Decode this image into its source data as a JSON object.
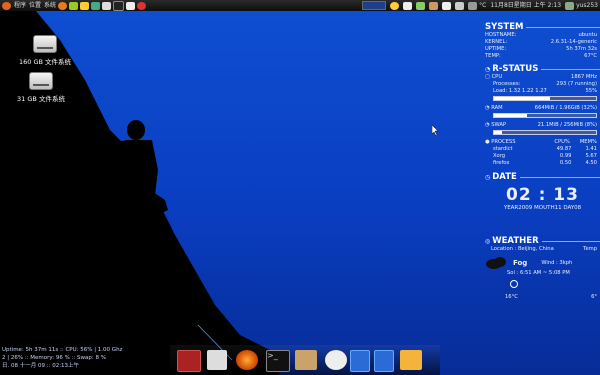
{
  "topbar": {
    "menus": [
      "ubuntu",
      "程序",
      "位置",
      "系统"
    ],
    "right": {
      "weather": "°C",
      "datetime": "11月8日星期日 上午 2:13",
      "user": "yus253"
    }
  },
  "desktop": {
    "icons": [
      {
        "label": "160 GB 文件系统"
      },
      {
        "label": "31 GB 文件系统"
      }
    ]
  },
  "conky": {
    "system": {
      "title": "SYSTEM",
      "rows": [
        [
          "HOSTNAME:",
          "ubuntu"
        ],
        [
          "KERNEL:",
          "2.6.31-14-generic"
        ],
        [
          "UPTIME:",
          "5h 37m 32s"
        ],
        [
          "TEMP:",
          "67°C"
        ]
      ]
    },
    "status": {
      "title": "R-STATUS",
      "cpu": {
        "label": "CPU",
        "value": "1867 MHz"
      },
      "processes": {
        "label": "Processes:",
        "value": "293 (7 running)"
      },
      "load": {
        "label": "Load: 1.32 1.22 1.27",
        "value": "55%"
      },
      "ram": {
        "label": "RAM",
        "value": "664MiB / 1.96GiB (32%)",
        "frac": 0.32
      },
      "swap": {
        "label": "SWAP",
        "value": "21.1MiB / 256MiB (8%)",
        "frac": 0.08
      }
    },
    "process": {
      "label": "PROCESS",
      "col_cpu": "CPU%",
      "col_mem": "MEM%",
      "rows": [
        {
          "name": "stardict",
          "cpu": "49.87",
          "mem": "1.41"
        },
        {
          "name": "Xorg",
          "cpu": "0.99",
          "mem": "5.67"
        },
        {
          "name": "firefox",
          "cpu": "0.50",
          "mem": "4.50"
        }
      ]
    },
    "date": {
      "title": "DATE",
      "clock": "02 : 13",
      "line": "YEAR2009 MOUTH11 DAY08"
    },
    "weather": {
      "title": "WEATHER",
      "location": "Location : Beijing, China",
      "temp_label": "Temp",
      "condition": "Fog",
      "wind": "Wind : 3kph",
      "sun": "Sol : 6:51 AM ~ 5:08 PM",
      "low": "16°C",
      "high": "6°"
    }
  },
  "bottom": {
    "line1": "Uptime: 5h 37m 11s :: CPU: 56% | 1.00 Ghz",
    "line2": "2 | 26% :: Memory: 96 % :: Swap: 8 %",
    "line3": "日. 08 十一月 09 :: 02:13上午"
  },
  "colors": {
    "sky": "#0a3ec1",
    "panel": "#1a1a1a",
    "silhouette": "#000000"
  }
}
